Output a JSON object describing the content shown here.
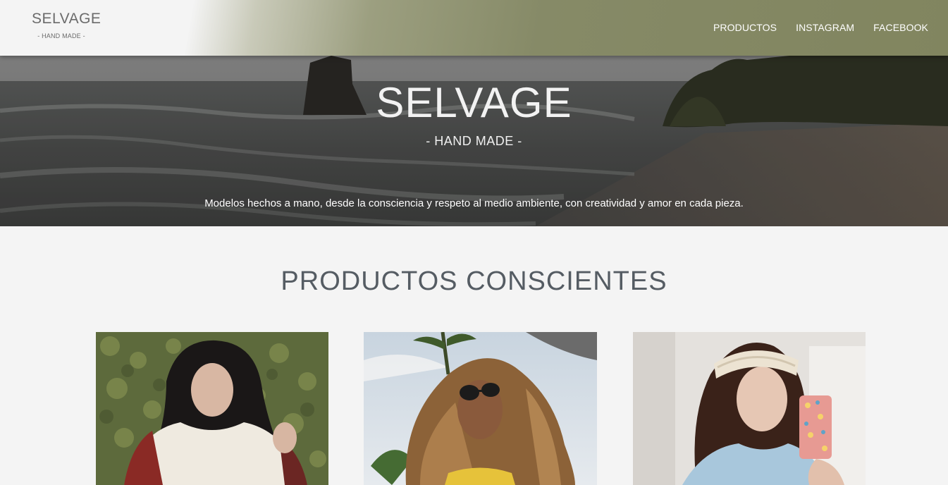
{
  "header": {
    "brand_name": "SELVAGE",
    "brand_tagline": "- HAND MADE -",
    "nav": [
      {
        "label": "PRODUCTOS"
      },
      {
        "label": "INSTAGRAM"
      },
      {
        "label": "FACEBOOK"
      }
    ]
  },
  "hero": {
    "title": "SELVAGE",
    "subtitle": "- HAND MADE -",
    "description": "Modelos hechos a mano, desde la consciencia y respeto al medio ambiente, con creatividad y amor en cada pieza."
  },
  "products_section": {
    "title": "PRODUCTOS CONSCIENTES",
    "cards": [
      {
        "image": "woman-sweater-photo"
      },
      {
        "image": "woman-sunglasses-photo"
      },
      {
        "image": "woman-headband-photo"
      }
    ]
  },
  "colors": {
    "header_olive": "#81855f",
    "page_background": "#f4f4f4",
    "section_title": "#555c63"
  }
}
